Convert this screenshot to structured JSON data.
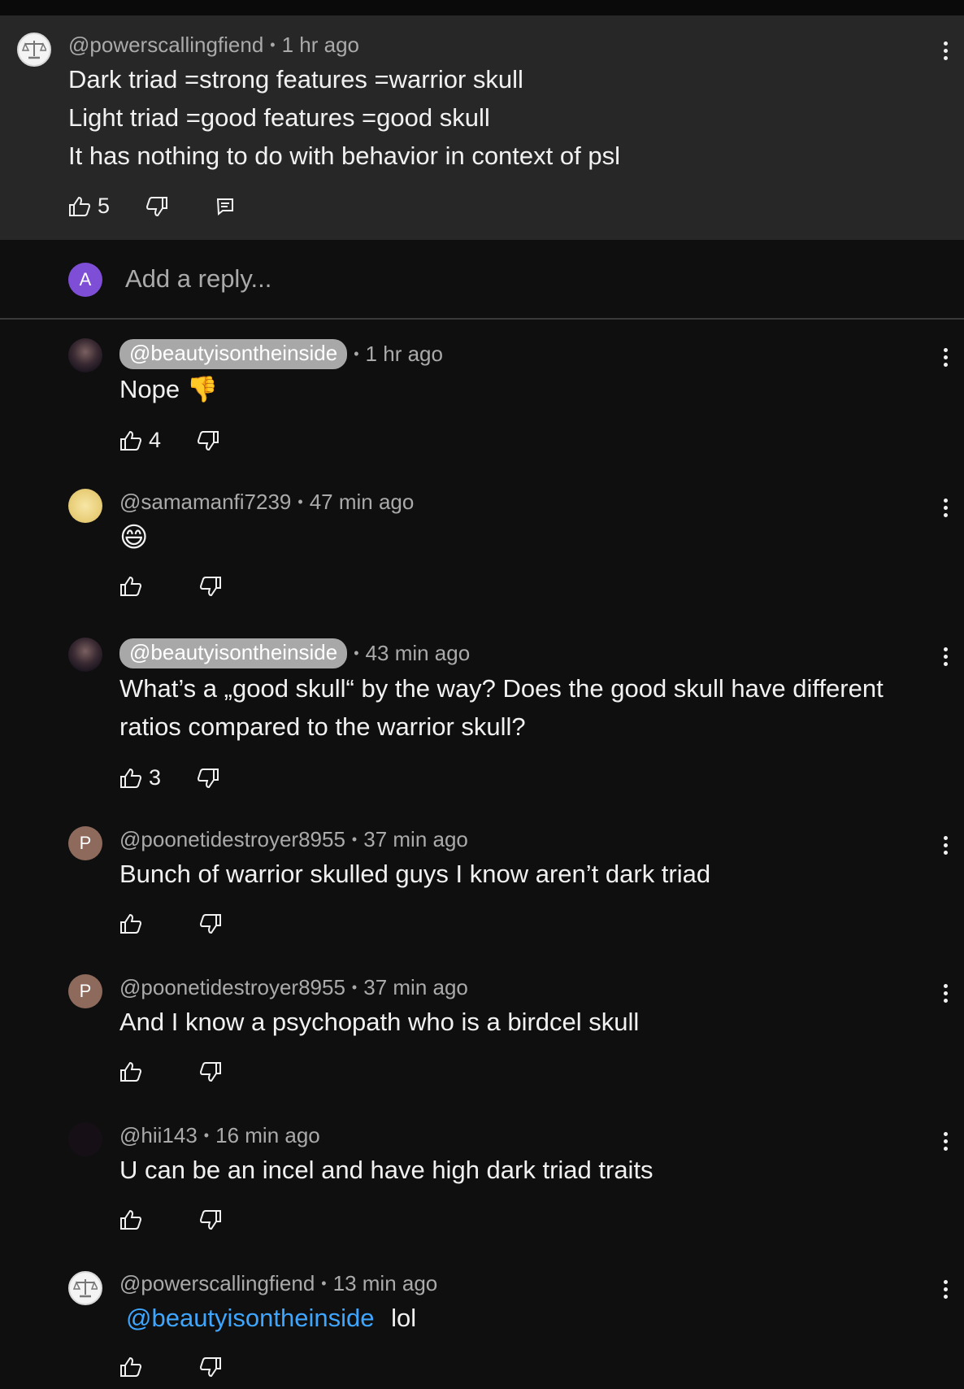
{
  "top_comment": {
    "author": "@powerscallingfiend",
    "time": "1 hr ago",
    "lines": [
      "Dark triad =strong features =warrior skull",
      "Light triad =good features =good skull",
      "It has nothing to do with behavior in context of psl"
    ],
    "likes": "5"
  },
  "reply_box": {
    "avatar_letter": "A",
    "placeholder": "Add a reply..."
  },
  "replies": [
    {
      "author": "@beautyisontheinside",
      "time": "1 hr ago",
      "text": "Nope",
      "emoji": "👎",
      "likes": "4"
    },
    {
      "author": "@samamanfi7239",
      "time": "47 min ago",
      "emoji": "😄",
      "likes": ""
    },
    {
      "author": "@beautyisontheinside",
      "time": "43 min ago",
      "line1": "What’s a „good skull“ by the way? Does the good skull have different",
      "line2": "ratios compared to the warrior skull?",
      "likes": "3"
    },
    {
      "author": "@poonetidestroyer8955",
      "avatar_letter": "P",
      "time": "37 min ago",
      "text": "Bunch of warrior skulled guys I know aren’t dark triad",
      "likes": ""
    },
    {
      "author": "@poonetidestroyer8955",
      "avatar_letter": "P",
      "time": "37 min ago",
      "text": "And I know a psychopath who is a birdcel skull",
      "likes": ""
    },
    {
      "author": "@hii143",
      "time": "16 min ago",
      "text": "U can be an incel and have high dark triad traits",
      "likes": ""
    },
    {
      "author": "@powerscallingfiend",
      "time": "13 min ago",
      "mention": "@beautyisontheinside",
      "text": "lol",
      "likes": ""
    }
  ],
  "icons": {
    "like": "thumbs-up-icon",
    "dislike": "thumbs-down-icon",
    "reply": "comment-icon",
    "more": "more-vert-icon",
    "scale_avatar": "scale-icon"
  },
  "colors": {
    "background": "#0f0f0f",
    "top_comment_bg": "#272727",
    "mention": "#3ea6ff",
    "reply_avatar": "#7e4fd6",
    "p_avatar": "#8d6a5c"
  }
}
